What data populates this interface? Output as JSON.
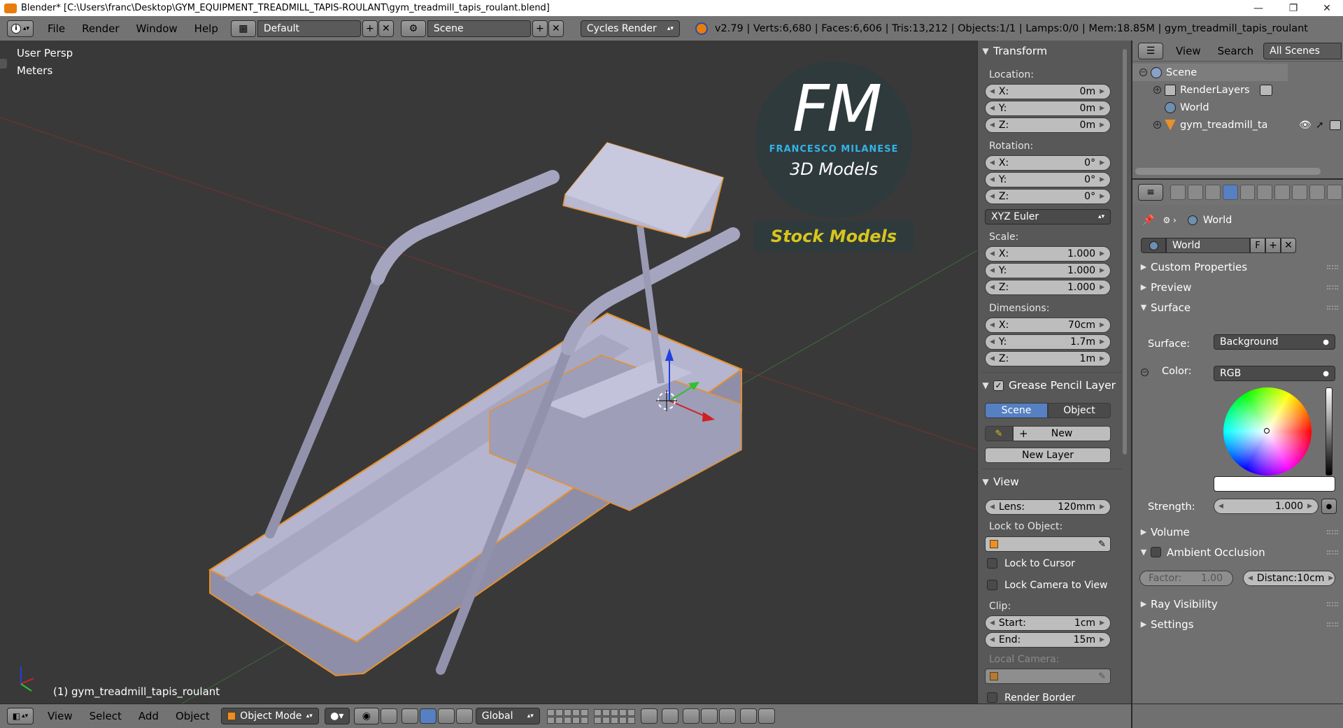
{
  "window": {
    "title": "Blender* [C:\\Users\\franc\\Desktop\\GYM_EQUIPMENT_TREADMILL_TAPIS-ROULANT\\gym_treadmill_tapis_roulant.blend]",
    "minimize": "—",
    "maximize": "❐",
    "close": "✕"
  },
  "infobar": {
    "editor_icon": "info-icon",
    "menus": [
      "File",
      "Render",
      "Window",
      "Help"
    ],
    "screen_layout": "Default",
    "scene": "Scene",
    "render_engine": "Cycles Render",
    "stats": "v2.79 | Verts:6,680 | Faces:6,606 | Tris:13,212 | Objects:1/1 | Lamps:0/0 | Mem:18.85M | gym_treadmill_tapis_roulant"
  },
  "viewport": {
    "view_name": "User Persp",
    "units": "Meters",
    "object_label": "(1) gym_treadmill_tapis_roulant",
    "logo": {
      "letters": "FM",
      "line1": "FRANCESCO MILANESE",
      "line2": "3D Models",
      "banner": "Stock Models"
    },
    "colors": {
      "background": "#393939",
      "model": "#b5b5cf",
      "selection_outline": "#e8902a",
      "axis_x": "#d02020",
      "axis_y": "#30c030",
      "axis_z": "#2040e0"
    }
  },
  "npanel": {
    "transform": {
      "title": "Transform",
      "location_label": "Location:",
      "location": [
        {
          "axis": "X:",
          "value": "0m"
        },
        {
          "axis": "Y:",
          "value": "0m"
        },
        {
          "axis": "Z:",
          "value": "0m"
        }
      ],
      "rotation_label": "Rotation:",
      "rotation": [
        {
          "axis": "X:",
          "value": "0°"
        },
        {
          "axis": "Y:",
          "value": "0°"
        },
        {
          "axis": "Z:",
          "value": "0°"
        }
      ],
      "rotation_mode": "XYZ Euler",
      "scale_label": "Scale:",
      "scale": [
        {
          "axis": "X:",
          "value": "1.000"
        },
        {
          "axis": "Y:",
          "value": "1.000"
        },
        {
          "axis": "Z:",
          "value": "1.000"
        }
      ],
      "dimensions_label": "Dimensions:",
      "dimensions": [
        {
          "axis": "X:",
          "value": "70cm"
        },
        {
          "axis": "Y:",
          "value": "1.7m"
        },
        {
          "axis": "Z:",
          "value": "1m"
        }
      ]
    },
    "grease_pencil": {
      "title": "Grease Pencil Layer",
      "tab_scene": "Scene",
      "tab_object": "Object",
      "new_label": "New",
      "new_layer_label": "New Layer"
    },
    "view": {
      "title": "View",
      "lens_label": "Lens:",
      "lens_value": "120mm",
      "lock_to_object_label": "Lock to Object:",
      "lock_to_cursor": "Lock to Cursor",
      "lock_camera_to_view": "Lock Camera to View",
      "clip_label": "Clip:",
      "clip_start_label": "Start:",
      "clip_start": "1cm",
      "clip_end_label": "End:",
      "clip_end": "15m",
      "local_camera_label": "Local Camera:",
      "render_border": "Render Border"
    }
  },
  "outliner": {
    "header": [
      "View",
      "Search"
    ],
    "filter": "All Scenes",
    "items": [
      {
        "label": "Scene",
        "icon": "scene-icon"
      },
      {
        "label": "RenderLayers",
        "icon": "render-layers-icon"
      },
      {
        "label": "World",
        "icon": "world-icon"
      },
      {
        "label": "gym_treadmill_tapis_roulant",
        "icon": "mesh-object-icon"
      }
    ]
  },
  "properties": {
    "breadcrumb": "World",
    "world_datablock": "World",
    "fake_user": "F",
    "sections": {
      "custom_properties": "Custom Properties",
      "preview": "Preview",
      "surface": "Surface",
      "volume": "Volume",
      "ambient_occlusion": "Ambient Occlusion",
      "ray_visibility": "Ray Visibility",
      "settings": "Settings"
    },
    "surface_label": "Surface:",
    "surface_value": "Background",
    "color_label": "Color:",
    "color_mode": "RGB",
    "strength_label": "Strength:",
    "strength_value": "1.000",
    "ao_factor_label": "Factor:",
    "ao_factor_value": "1.00",
    "ao_distance_label": "Distanc:",
    "ao_distance_value": "10cm"
  },
  "bottombar": {
    "menus": [
      "View",
      "Select",
      "Add",
      "Object"
    ],
    "mode": "Object Mode",
    "orientation": "Global"
  }
}
